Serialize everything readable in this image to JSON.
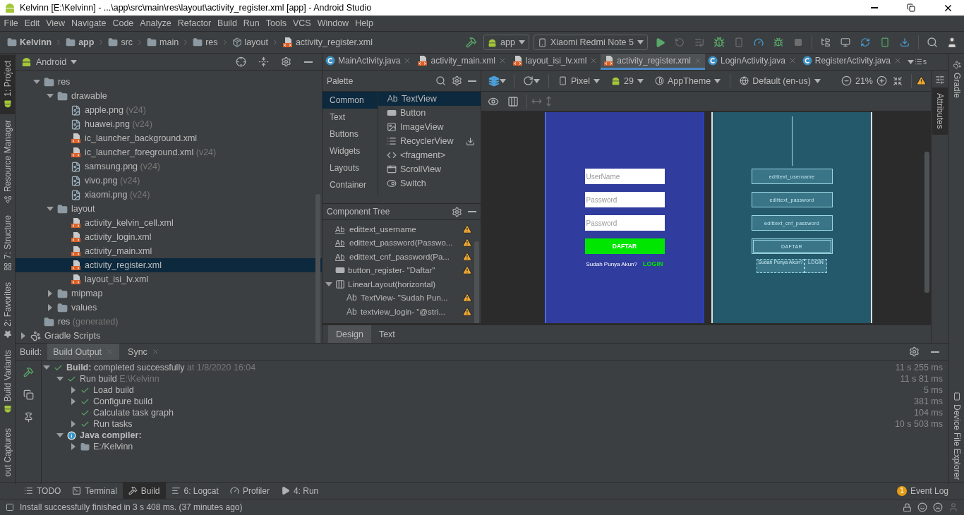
{
  "window": {
    "title": "Kelvinn [E:\\Kelvinn] - ...\\app\\src\\main\\res\\layout\\activity_register.xml [app] - Android Studio"
  },
  "menu": [
    "File",
    "Edit",
    "View",
    "Navigate",
    "Code",
    "Analyze",
    "Refactor",
    "Build",
    "Run",
    "Tools",
    "VCS",
    "Window",
    "Help"
  ],
  "breadcrumbs": [
    {
      "label": "Kelvinn",
      "kind": "project",
      "bold": true
    },
    {
      "label": "app",
      "kind": "module",
      "bold": true
    },
    {
      "label": "src",
      "kind": "folder",
      "bold": false
    },
    {
      "label": "main",
      "kind": "folder",
      "bold": false
    },
    {
      "label": "res",
      "kind": "res",
      "bold": false
    },
    {
      "label": "layout",
      "kind": "package",
      "bold": false
    },
    {
      "label": "activity_register.xml",
      "kind": "xml",
      "bold": false
    }
  ],
  "run_toolbar": {
    "config": "app",
    "device": "Xiaomi Redmi Note 5"
  },
  "left_tools": [
    {
      "label": "1: Project",
      "kind": "android",
      "selected": true
    },
    {
      "label": "Resource Manager",
      "kind": "shapes",
      "selected": false
    },
    {
      "label": "7: Structure",
      "kind": "grid",
      "selected": false
    },
    {
      "label": "2: Favorites",
      "kind": "star",
      "selected": false
    }
  ],
  "left_tools_bottom": [
    {
      "label": "Build Variants",
      "kind": "android",
      "selected": false
    },
    {
      "label": "out Captures",
      "kind": "none",
      "selected": false
    }
  ],
  "right_tools": [
    {
      "label": "Gradle",
      "kind": "gradle",
      "selected": false
    }
  ],
  "right_tools_bottom": [
    {
      "label": "Device File Explorer",
      "kind": "phone",
      "selected": false
    }
  ],
  "project": {
    "view": "Android",
    "tree": [
      {
        "label": "res",
        "kind": "res",
        "expanded": true,
        "selected": false,
        "children": [
          {
            "label": "drawable",
            "kind": "folder",
            "expanded": true,
            "selected": false,
            "children": [
              {
                "label": "apple.png",
                "note": "(v24)",
                "kind": "image",
                "selected": false
              },
              {
                "label": "huawei.png",
                "note": "(v24)",
                "kind": "image",
                "selected": false
              },
              {
                "label": "ic_launcher_background.xml",
                "kind": "xml",
                "selected": false
              },
              {
                "label": "ic_launcher_foreground.xml",
                "note": "(v24)",
                "kind": "xml",
                "selected": false
              },
              {
                "label": "samsung.png",
                "note": "(v24)",
                "kind": "image",
                "selected": false
              },
              {
                "label": "vivo.png",
                "note": "(v24)",
                "kind": "image",
                "selected": false
              },
              {
                "label": "xiaomi.png",
                "note": "(v24)",
                "kind": "image",
                "selected": false
              }
            ]
          },
          {
            "label": "layout",
            "kind": "folder",
            "expanded": true,
            "selected": false,
            "children": [
              {
                "label": "activity_kelvin_cell.xml",
                "kind": "xml",
                "selected": false
              },
              {
                "label": "activity_login.xml",
                "kind": "xml",
                "selected": false
              },
              {
                "label": "activity_main.xml",
                "kind": "xml",
                "selected": false
              },
              {
                "label": "activity_register.xml",
                "kind": "xml",
                "selected": true
              },
              {
                "label": "layout_isi_lv.xml",
                "kind": "xml",
                "selected": false
              }
            ]
          },
          {
            "label": "mipmap",
            "kind": "folder",
            "expanded": false,
            "selected": false
          },
          {
            "label": "values",
            "kind": "folder",
            "expanded": false,
            "selected": false
          }
        ]
      },
      {
        "label": "res",
        "note": "(generated)",
        "kind": "res",
        "selected": false
      },
      {
        "label": "Gradle Scripts",
        "kind": "gradle",
        "expanded": false,
        "selected": false
      }
    ]
  },
  "editor_tabs": [
    {
      "label": "MainActivity.java",
      "kind": "java",
      "selected": false
    },
    {
      "label": "activity_main.xml",
      "kind": "xml",
      "selected": false
    },
    {
      "label": "layout_isi_lv.xml",
      "kind": "xml",
      "selected": false
    },
    {
      "label": "activity_register.xml",
      "kind": "xml",
      "selected": true
    },
    {
      "label": "LoginActivity.java",
      "kind": "java",
      "selected": false
    },
    {
      "label": "RegisterActivity.java",
      "kind": "java",
      "selected": false
    }
  ],
  "tab_overflow_count": "5",
  "design_toolbar": {
    "device": "Pixel",
    "api": "29",
    "theme": "AppTheme",
    "locale": "Default (en-us)",
    "zoom": "21%"
  },
  "palette": {
    "title": "Palette",
    "categories": [
      {
        "label": "Common",
        "selected": true
      },
      {
        "label": "Text",
        "selected": false
      },
      {
        "label": "Buttons",
        "selected": false
      },
      {
        "label": "Widgets",
        "selected": false
      },
      {
        "label": "Layouts",
        "selected": false
      },
      {
        "label": "Container",
        "selected": false
      }
    ],
    "items": [
      {
        "label": "TextView",
        "kind": "text",
        "glyph": "Ab",
        "selected": true,
        "download": false
      },
      {
        "label": "Button",
        "kind": "button",
        "selected": false,
        "download": false
      },
      {
        "label": "ImageView",
        "kind": "image",
        "selected": false,
        "download": false
      },
      {
        "label": "RecyclerView",
        "kind": "list",
        "selected": false,
        "download": true
      },
      {
        "label": "<fragment>",
        "kind": "code",
        "selected": false,
        "download": false
      },
      {
        "label": "ScrollView",
        "kind": "scroll",
        "selected": false,
        "download": false
      },
      {
        "label": "Switch",
        "kind": "switch",
        "selected": false,
        "download": false
      }
    ]
  },
  "component_tree": {
    "title": "Component Tree",
    "items": [
      {
        "label": "edittext_username",
        "kind": "edittext",
        "glyph": "Ab",
        "warning": true
      },
      {
        "label": "edittext_password(Passwo...",
        "kind": "edittext",
        "glyph": "Ab",
        "warning": true
      },
      {
        "label": "edittext_cnf_password(Pa...",
        "kind": "edittext",
        "glyph": "Ab",
        "warning": true
      },
      {
        "label": "button_register- \"Daftar\"",
        "kind": "button",
        "warning": true
      },
      {
        "label": "LinearLayout(horizontal)",
        "kind": "linear",
        "warning": false,
        "expanded": true,
        "children": [
          {
            "label": "TextView- \"Sudah Pun...",
            "kind": "text",
            "glyph": "Ab",
            "warning": true
          },
          {
            "label": "textview_login- \"@stri...",
            "kind": "text",
            "glyph": "Ab",
            "warning": true
          }
        ]
      }
    ]
  },
  "preview": {
    "fields": [
      {
        "placeholder": "UserName"
      },
      {
        "placeholder": "Password"
      },
      {
        "placeholder": "Password"
      }
    ],
    "button": "DAFTAR",
    "prompt": "Sudah Punya Akun?",
    "link": "LOGIN"
  },
  "blueprint": {
    "fields": [
      "edittext_username",
      "edittext_password",
      "edittext_cnf_password"
    ],
    "button": "DAFTAR",
    "prompt": "Sudah Punya Akun?",
    "link": "LOGIN"
  },
  "mode_tabs": [
    {
      "label": "Design",
      "selected": true
    },
    {
      "label": "Text",
      "selected": false
    }
  ],
  "attributes_tab": {
    "label": "Attributes",
    "selected": true
  },
  "build": {
    "label": "Build:",
    "tabs": [
      {
        "label": "Build Output",
        "selected": true
      },
      {
        "label": "Sync",
        "selected": false
      }
    ],
    "tree": [
      {
        "label": "**Build:** completed successfully",
        "note": "at 1/8/2020 16:04",
        "time": "11 s 255 ms",
        "kind": "success",
        "bold": false,
        "expanded": true,
        "children": [
          {
            "label": "Run build",
            "note": "E:\\Kelvinn",
            "time": "11 s 81 ms",
            "kind": "success",
            "bold": false,
            "expanded": true,
            "children": [
              {
                "label": "Load build",
                "time": "5 ms",
                "kind": "success",
                "bold": false,
                "expanded": false
              },
              {
                "label": "Configure build",
                "time": "381 ms",
                "kind": "success",
                "bold": false,
                "expanded": false
              },
              {
                "label": "Calculate task graph",
                "time": "104 ms",
                "kind": "success",
                "bold": false
              },
              {
                "label": "Run tasks",
                "time": "10 s 503 ms",
                "kind": "success",
                "bold": false,
                "expanded": false
              }
            ]
          },
          {
            "label": "Java compiler:",
            "kind": "info",
            "bold": true,
            "expanded": true,
            "children": [
              {
                "label": "E:/Kelvinn",
                "kind": "folder",
                "bold": false,
                "expanded": false
              }
            ]
          }
        ]
      }
    ]
  },
  "bottom_tools": [
    {
      "label": "TODO",
      "kind": "list",
      "selected": false
    },
    {
      "label": "Terminal",
      "kind": "terminal",
      "selected": false
    },
    {
      "label": "Build",
      "kind": "hammer",
      "selected": true
    },
    {
      "label": "6: Logcat",
      "kind": "log",
      "selected": false
    },
    {
      "label": "Profiler",
      "kind": "gauge",
      "selected": false
    },
    {
      "label": "4: Run",
      "kind": "run",
      "selected": false
    }
  ],
  "event_log": {
    "label": "Event Log",
    "count": "1"
  },
  "status": "Install successfully finished in 3 s 408 ms. (37 minutes ago)"
}
